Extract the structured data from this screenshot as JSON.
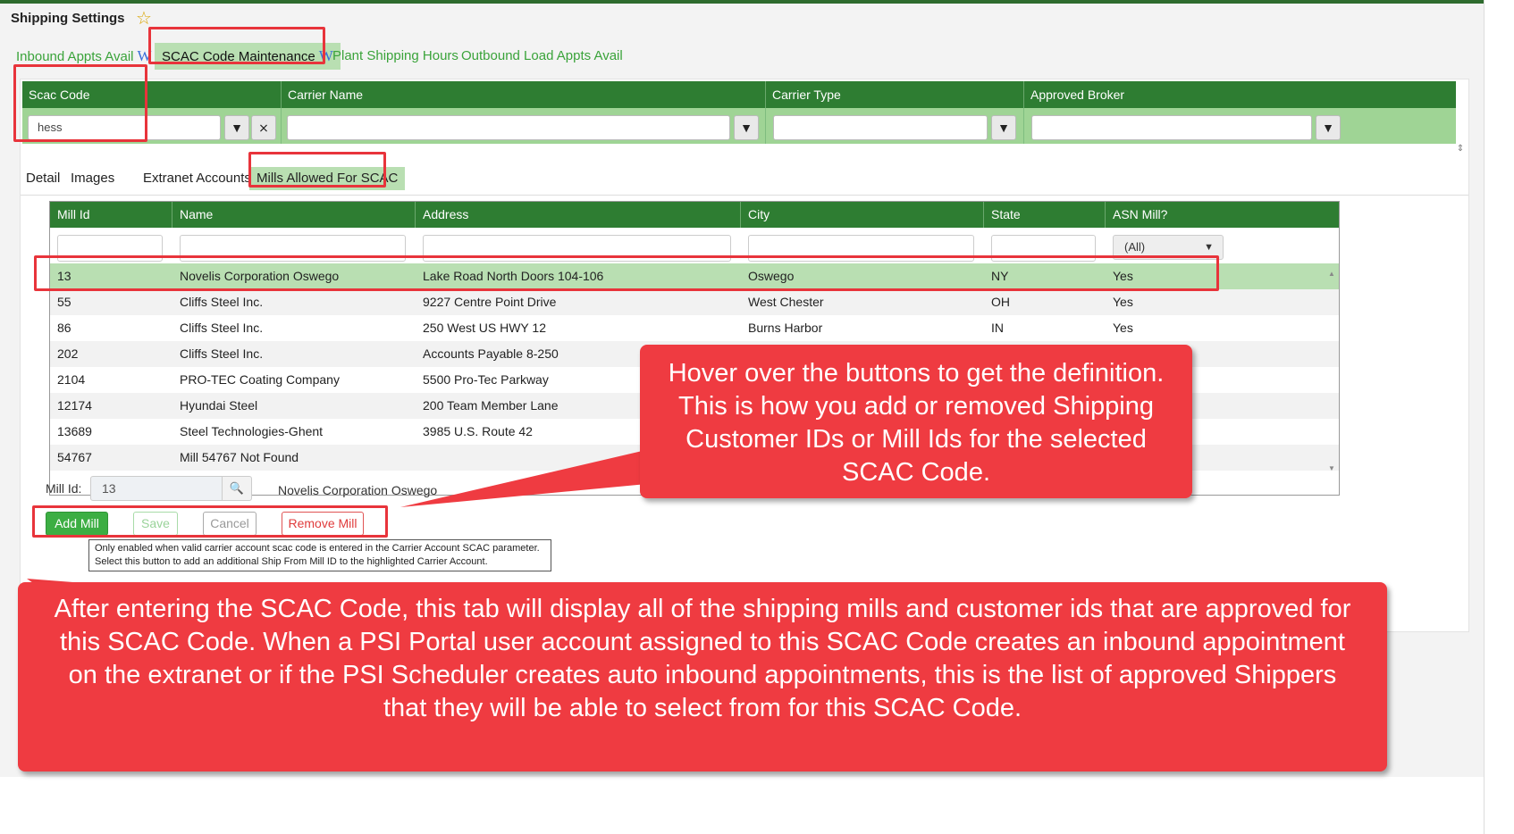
{
  "page": {
    "title": "Shipping Settings"
  },
  "top_tabs": [
    {
      "label": "Inbound Appts Avail",
      "wiki": "W"
    },
    {
      "label": "SCAC Code Maintenance",
      "wiki": "W"
    },
    {
      "label": "Plant Shipping Hours"
    },
    {
      "label": "Outbound Load Appts Avail"
    }
  ],
  "carrier_grid": {
    "columns": [
      "Scac Code",
      "Carrier Name",
      "Carrier Type",
      "Approved Broker"
    ],
    "filter_values": {
      "scac_code": "hess"
    }
  },
  "detail_tabs": [
    "Detail",
    "Images",
    "Extranet Accounts",
    "Mills Allowed For SCAC"
  ],
  "mills_grid": {
    "columns": [
      "Mill Id",
      "Name",
      "Address",
      "City",
      "State",
      "ASN Mill?"
    ],
    "asn_filter": "(All)",
    "rows": [
      {
        "id": "13",
        "name": "Novelis Corporation Oswego",
        "address": "Lake Road North Doors 104-106",
        "city": "Oswego",
        "state": "NY",
        "asn": "Yes"
      },
      {
        "id": "55",
        "name": "Cliffs Steel Inc.",
        "address": "9227 Centre Point Drive",
        "city": "West Chester",
        "state": "OH",
        "asn": "Yes"
      },
      {
        "id": "86",
        "name": "Cliffs Steel Inc.",
        "address": "250 West US HWY 12",
        "city": "Burns Harbor",
        "state": "IN",
        "asn": "Yes"
      },
      {
        "id": "202",
        "name": "Cliffs Steel Inc.",
        "address": "Accounts Payable 8-250",
        "city": "",
        "state": "",
        "asn": ""
      },
      {
        "id": "2104",
        "name": "PRO-TEC Coating Company",
        "address": "5500 Pro-Tec Parkway",
        "city": "",
        "state": "",
        "asn": ""
      },
      {
        "id": "12174",
        "name": "Hyundai Steel",
        "address": "200 Team Member Lane",
        "city": "",
        "state": "",
        "asn": ""
      },
      {
        "id": "13689",
        "name": "Steel Technologies-Ghent",
        "address": "3985 U.S. Route 42",
        "city": "",
        "state": "",
        "asn": ""
      },
      {
        "id": "54767",
        "name": "Mill 54767 Not Found",
        "address": "",
        "city": "",
        "state": "",
        "asn": ""
      }
    ]
  },
  "mill_editor": {
    "label": "Mill Id:",
    "value": "13",
    "name": "Novelis Corporation Oswego",
    "buttons": {
      "add": "Add Mill",
      "save": "Save",
      "cancel": "Cancel",
      "remove": "Remove Mill"
    },
    "tooltip": "Only enabled when valid carrier account scac code is entered in the Carrier Account SCAC parameter. Select this button to add an additional Ship From Mill ID to the highlighted Carrier Account."
  },
  "callouts": {
    "buttons_note": "Hover over the buttons to get the definition. This is how you add or removed Shipping Customer IDs or Mill Ids for the selected SCAC Code.",
    "tab_note": "After entering the SCAC Code, this tab will display all of the shipping mills and customer ids that are approved for this SCAC Code. When a PSI Portal user account assigned to this SCAC Code creates an inbound appointment on the extranet or if the PSI Scheduler creates auto inbound appointments, this is the list of approved Shippers that they will be able to select from for this SCAC Code."
  },
  "colors": {
    "header_green": "#2e7d32",
    "highlight_green": "#b9dfb2",
    "callout_red": "#ef3b41",
    "annotation_red": "#e8343b"
  }
}
